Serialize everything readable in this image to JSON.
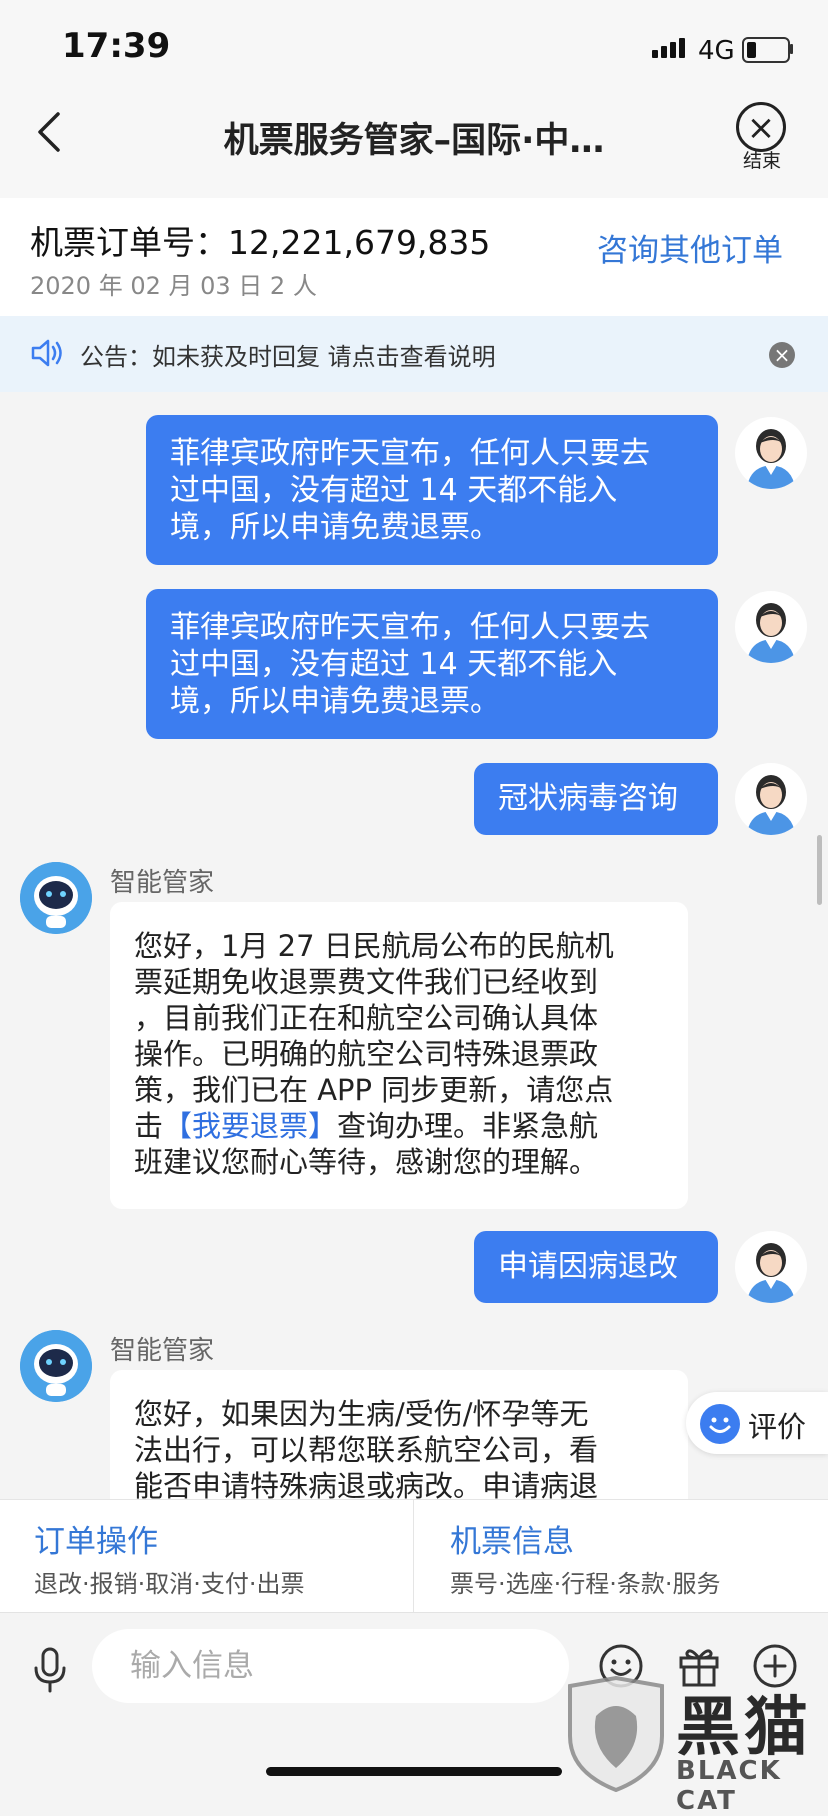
{
  "status_bar": {
    "time": "17:39",
    "network": "4G"
  },
  "nav": {
    "title": "机票服务管家–国际·中…",
    "end_label": "结束"
  },
  "order": {
    "number_label": "机票订单号：12,221,679,835",
    "date_info": "2020 年 02 月 03 日  2 人",
    "other_orders_link": "咨询其他订单"
  },
  "notice": {
    "text": "公告：如未获及时回复 请点击查看说明"
  },
  "chat": {
    "user_msg_1": [
      "菲律宾政府昨天宣布，任何人只要去",
      "过中国，没有超过 14 天都不能入",
      "境，所以申请免费退票。"
    ],
    "user_msg_2": [
      "菲律宾政府昨天宣布，任何人只要去",
      "过中国，没有超过 14 天都不能入",
      "境，所以申请免费退票。"
    ],
    "user_msg_3": "冠状病毒咨询",
    "bot_name": "智能管家",
    "bot_msg_1": {
      "lines": [
        "您好，1月 27 日民航局公布的民航机",
        "票延期免收退票费文件我们已经收到",
        "，目前我们正在和航空公司确认具体",
        "操作。已明确的航空公司特殊退票政",
        "策，我们已在 APP 同步更新，请您点"
      ],
      "pre_link": "击",
      "link": "【我要退票】",
      "post_link": "查询办理。非紧急航",
      "last_line": "班建议您耐心等待，感谢您的理解。"
    },
    "user_msg_4": "申请因病退改",
    "bot_name_2": "智能管家",
    "bot_msg_2": [
      "您好，如果因为生病/受伤/怀孕等无",
      "法出行，可以帮您联系航空公司，看",
      "能否申请特殊病退或病改。申请病退"
    ]
  },
  "rate_button": {
    "label": "评价"
  },
  "actions": {
    "order_ops": {
      "title": "订单操作",
      "sub": "退改·报销·取消·支付·出票"
    },
    "ticket_info": {
      "title": "机票信息",
      "sub": "票号·选座·行程·条款·服务"
    }
  },
  "input": {
    "placeholder": "输入信息"
  },
  "watermark": {
    "text": "黑猫",
    "sub": "BLACK CAT"
  },
  "colors": {
    "accent": "#3c7df0",
    "link": "#3477d6"
  }
}
